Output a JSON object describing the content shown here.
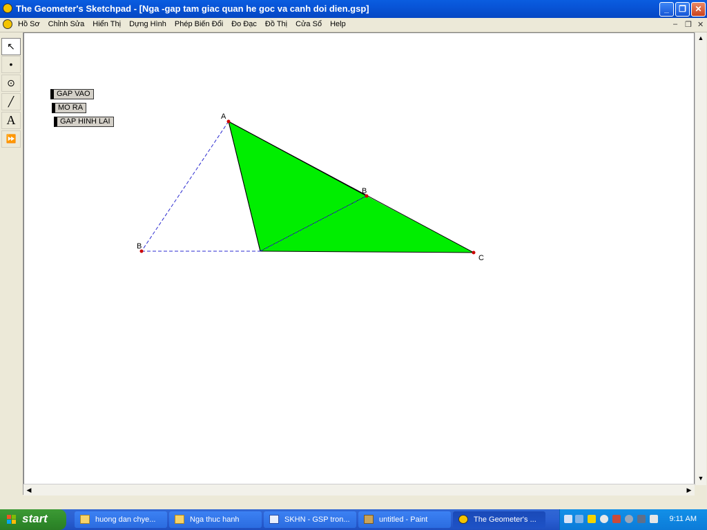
{
  "window": {
    "title": "The Geometer's Sketchpad - [Nga -gap tam giac quan he goc va canh doi dien.gsp]",
    "minimize_glyph": "_",
    "maximize_glyph": "❐",
    "close_glyph": "✕"
  },
  "menu": {
    "items": [
      "Hồ Sơ",
      "Chỉnh Sửa",
      "Hiển Thị",
      "Dựng Hình",
      "Phép Biến Đổi",
      "Đo Đạc",
      "Đồ Thị",
      "Cửa Sổ",
      "Help"
    ],
    "mdi_min": "–",
    "mdi_restore": "❐",
    "mdi_close": "✕"
  },
  "toolbox": {
    "tools": [
      {
        "name": "selection-arrow-icon",
        "glyph": "↖",
        "active": true
      },
      {
        "name": "point-tool-icon",
        "glyph": "•",
        "active": false
      },
      {
        "name": "compass-tool-icon",
        "glyph": "⊙",
        "active": false
      },
      {
        "name": "straightedge-tool-icon",
        "glyph": "╱",
        "active": false
      },
      {
        "name": "text-tool-icon",
        "glyph": "A",
        "active": false
      },
      {
        "name": "custom-tool-icon",
        "glyph": "⏩",
        "active": false
      }
    ]
  },
  "sketch": {
    "buttons": [
      "GAP VAO",
      "MO RA",
      "GAP HINH LAI"
    ],
    "points": {
      "A": "A",
      "B1": "B",
      "B2": "B",
      "C": "C"
    },
    "fill_color": "#00ee00",
    "point_color": "#cc0000"
  },
  "taskbar": {
    "start_label": "start",
    "tasks": [
      {
        "label": "huong dan chye...",
        "icon": "folder-icon",
        "active": false
      },
      {
        "label": "Nga thuc hanh",
        "icon": "folder-icon",
        "active": false
      },
      {
        "label": "SKHN - GSP tron...",
        "icon": "word-document-icon",
        "active": false
      },
      {
        "label": "untitled - Paint",
        "icon": "paint-icon",
        "active": false
      },
      {
        "label": "The Geometer's ...",
        "icon": "sketchpad-icon",
        "active": true
      }
    ],
    "clock": "9:11 AM"
  }
}
